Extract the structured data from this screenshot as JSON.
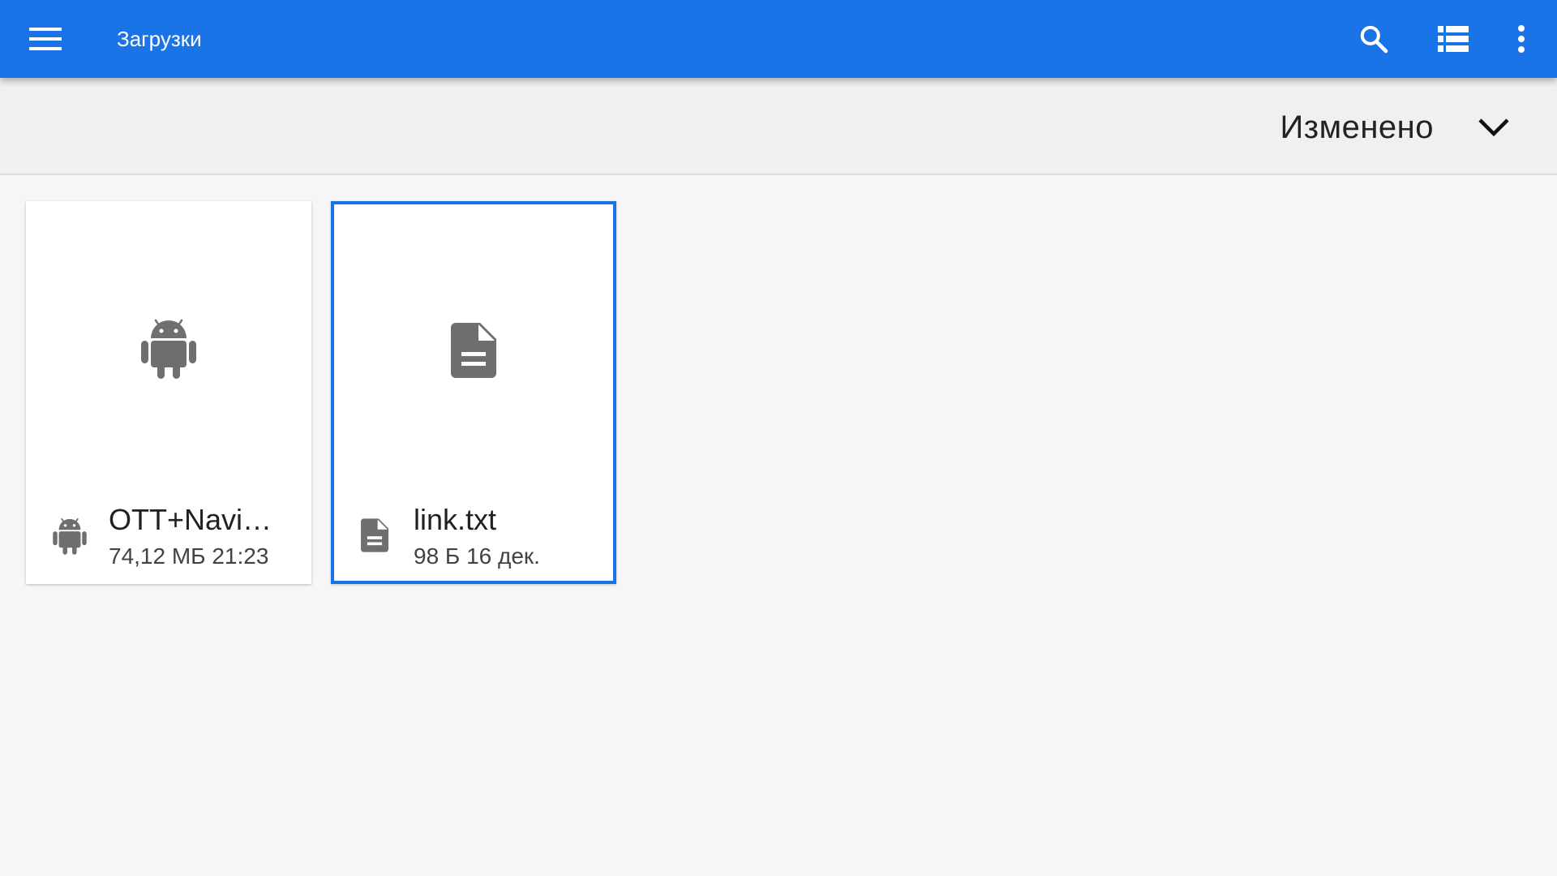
{
  "appbar": {
    "title": "Загрузки",
    "menu_icon": "hamburger-menu-icon",
    "actions": [
      "search-icon",
      "list-view-icon",
      "more-vert-icon"
    ],
    "background": "#1b73e8"
  },
  "sortbar": {
    "label": "Изменено",
    "toggle_icon": "chevron-down-icon"
  },
  "files": [
    {
      "name": "OTT+Navig…",
      "details": "74,12 МБ 21:23",
      "icon": "android-icon",
      "selected": false
    },
    {
      "name": "link.txt",
      "details": "98 Б 16 дек.",
      "icon": "text-document-icon",
      "selected": true
    }
  ],
  "colors": {
    "accent": "#1b73e8",
    "icon_gray": "#6f6f6f",
    "background": "#f6f6f6"
  }
}
